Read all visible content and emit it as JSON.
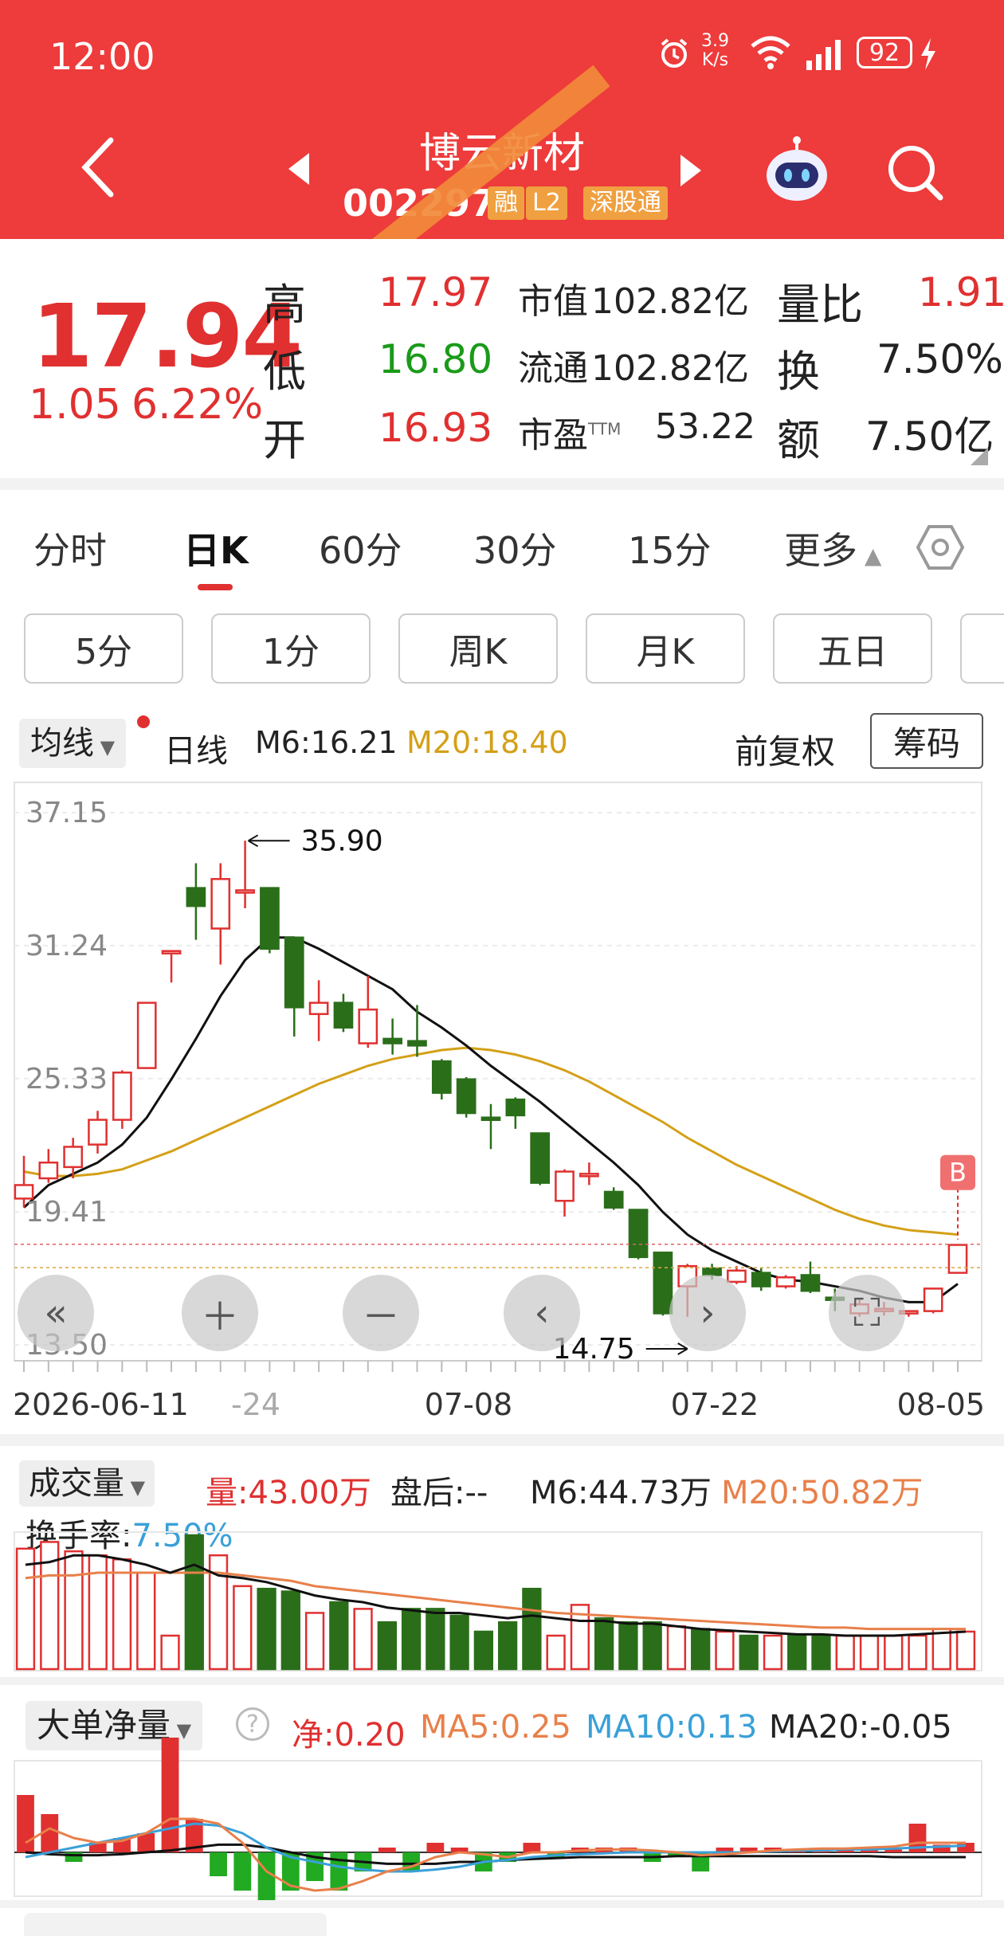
{
  "status_bar": {
    "time": "12:00",
    "net_speed_top": "3.9",
    "net_speed_unit": "K/s",
    "battery": "92"
  },
  "header": {
    "stock_name": "博云新材",
    "stock_code": "002297",
    "tags": [
      "融",
      "L2",
      "深股通"
    ]
  },
  "quote": {
    "price": "17.94",
    "change": "1.05",
    "change_pct": "6.22%",
    "high_label": "高",
    "high": "17.97",
    "low_label": "低",
    "low": "16.80",
    "open_label": "开",
    "open": "16.93",
    "mcap_label": "市值",
    "mcap": "102.82亿",
    "float_label": "流通",
    "float": "102.82亿",
    "pe_label": "市盈",
    "pe_sup": "TTM",
    "pe": "53.22",
    "vr_label": "量比",
    "vr": "1.91",
    "turnover_label": "换",
    "turnover": "7.50%",
    "amount_label": "额",
    "amount": "7.50亿"
  },
  "tabs": [
    "分时",
    "日K",
    "60分",
    "30分",
    "15分",
    "更多"
  ],
  "subtabs": [
    "5分",
    "1分",
    "周K",
    "月K",
    "五日"
  ],
  "ma_line": {
    "indicator": "均线",
    "period": "日线",
    "m6": "M6:16.21",
    "m20": "M20:18.40",
    "adjust": "前复权",
    "chip": "筹码"
  },
  "colors": {
    "header_red": "#ee3b3b",
    "up_red": "#e03030",
    "down_green": "#2a6e1a",
    "m20_gold": "#d4a017",
    "ma5_orange": "#e8804a",
    "ma10_blue": "#3aa0d8"
  },
  "chart_data": {
    "type": "candlestick",
    "y_ticks": [
      "37.15",
      "31.24",
      "25.33",
      "19.41",
      "13.50"
    ],
    "ylim": [
      13.5,
      37.15
    ],
    "x_ticks": [
      "2026-06-11",
      "-24",
      "07-08",
      "07-22",
      "08-05"
    ],
    "annotations": [
      {
        "label": "35.90",
        "marks": "high"
      },
      {
        "label": "14.75",
        "marks": "low"
      },
      {
        "label": "B",
        "marks": "buy"
      }
    ],
    "candles": [
      {
        "o": 20.0,
        "c": 20.6,
        "h": 21.9,
        "l": 19.6
      },
      {
        "o": 20.9,
        "c": 21.6,
        "h": 22.2,
        "l": 20.7
      },
      {
        "o": 21.4,
        "c": 22.3,
        "h": 22.7,
        "l": 20.9
      },
      {
        "o": 22.4,
        "c": 23.5,
        "h": 23.9,
        "l": 22.0
      },
      {
        "o": 23.5,
        "c": 25.6,
        "h": 25.7,
        "l": 23.1
      },
      {
        "o": 25.8,
        "c": 28.7,
        "h": 28.7,
        "l": 25.8
      },
      {
        "o": 31.0,
        "c": 31.0,
        "h": 31.0,
        "l": 29.6
      },
      {
        "o": 33.8,
        "c": 33.0,
        "h": 34.9,
        "l": 31.5
      },
      {
        "o": 32.0,
        "c": 34.2,
        "h": 34.9,
        "l": 30.4
      },
      {
        "o": 33.7,
        "c": 33.7,
        "h": 35.9,
        "l": 32.9
      },
      {
        "o": 33.8,
        "c": 31.1,
        "h": 33.8,
        "l": 30.9
      },
      {
        "o": 31.6,
        "c": 28.5,
        "h": 31.6,
        "l": 27.2
      },
      {
        "o": 28.2,
        "c": 28.7,
        "h": 29.7,
        "l": 27.0
      },
      {
        "o": 28.7,
        "c": 27.6,
        "h": 29.1,
        "l": 27.4
      },
      {
        "o": 26.9,
        "c": 28.4,
        "h": 29.9,
        "l": 26.7
      },
      {
        "o": 27.1,
        "c": 26.9,
        "h": 28.0,
        "l": 26.4
      },
      {
        "o": 27.0,
        "c": 26.8,
        "h": 28.6,
        "l": 26.3
      },
      {
        "o": 26.1,
        "c": 24.7,
        "h": 26.2,
        "l": 24.4
      },
      {
        "o": 25.3,
        "c": 23.8,
        "h": 25.4,
        "l": 23.6
      },
      {
        "o": 23.6,
        "c": 23.5,
        "h": 24.2,
        "l": 22.2
      },
      {
        "o": 24.4,
        "c": 23.7,
        "h": 24.5,
        "l": 23.1
      },
      {
        "o": 22.9,
        "c": 20.7,
        "h": 22.9,
        "l": 20.6
      },
      {
        "o": 19.9,
        "c": 21.2,
        "h": 21.3,
        "l": 19.2
      },
      {
        "o": 21.0,
        "c": 21.1,
        "h": 21.6,
        "l": 20.6
      },
      {
        "o": 20.3,
        "c": 19.6,
        "h": 20.5,
        "l": 19.5
      },
      {
        "o": 19.5,
        "c": 17.4,
        "h": 19.5,
        "l": 17.3
      },
      {
        "o": 17.6,
        "c": 14.9,
        "h": 17.6,
        "l": 14.8
      },
      {
        "o": 16.1,
        "c": 17.0,
        "h": 17.1,
        "l": 14.75
      },
      {
        "o": 16.9,
        "c": 16.6,
        "h": 17.1,
        "l": 16.4
      },
      {
        "o": 16.3,
        "c": 16.8,
        "h": 17.0,
        "l": 16.2
      },
      {
        "o": 16.7,
        "c": 16.1,
        "h": 16.9,
        "l": 15.9
      },
      {
        "o": 16.1,
        "c": 16.5,
        "h": 16.6,
        "l": 16.0
      },
      {
        "o": 16.6,
        "c": 15.9,
        "h": 17.2,
        "l": 15.8
      },
      {
        "o": 15.6,
        "c": 15.5,
        "h": 16.0,
        "l": 15.0
      },
      {
        "o": 14.9,
        "c": 15.3,
        "h": 15.5,
        "l": 14.75
      },
      {
        "o": 15.0,
        "c": 15.1,
        "h": 15.4,
        "l": 14.8
      },
      {
        "o": 14.9,
        "c": 15.0,
        "h": 15.0,
        "l": 14.75
      },
      {
        "o": 15.0,
        "c": 16.0,
        "h": 16.0,
        "l": 14.9
      },
      {
        "o": 16.7,
        "c": 17.94,
        "h": 17.97,
        "l": 16.8
      }
    ],
    "m6": [
      19.6,
      20.6,
      21.1,
      21.6,
      22.4,
      23.6,
      25.3,
      27.1,
      29.0,
      30.6,
      31.6,
      31.6,
      31.1,
      30.5,
      29.9,
      29.3,
      28.3,
      27.6,
      26.8,
      25.9,
      25.1,
      24.3,
      23.4,
      22.5,
      21.6,
      20.6,
      19.4,
      18.4,
      17.7,
      17.2,
      16.7,
      16.4,
      16.3,
      16.1,
      15.9,
      15.6,
      15.4,
      15.4,
      16.21
    ],
    "m20": [
      21.2,
      21.0,
      21.0,
      21.1,
      21.3,
      21.7,
      22.1,
      22.6,
      23.1,
      23.6,
      24.1,
      24.6,
      25.1,
      25.5,
      25.9,
      26.2,
      26.4,
      26.6,
      26.7,
      26.6,
      26.4,
      26.1,
      25.7,
      25.2,
      24.6,
      24.0,
      23.4,
      22.7,
      22.1,
      21.5,
      21.0,
      20.5,
      20.0,
      19.5,
      19.1,
      18.8,
      18.6,
      18.5,
      18.4
    ]
  },
  "volume": {
    "indicator": "成交量",
    "vol_label": "量:",
    "vol": "43.00万",
    "after_label": "盘后:--",
    "m6": "M6:44.73万",
    "m20": "M20:50.82万",
    "turnover_label": "换手率:",
    "turnover": "7.50%",
    "bars": [
      0.9,
      0.95,
      0.88,
      0.85,
      0.82,
      0.72,
      0.25,
      1.0,
      0.85,
      0.62,
      0.6,
      0.58,
      0.42,
      0.5,
      0.45,
      0.35,
      0.45,
      0.45,
      0.4,
      0.28,
      0.35,
      0.6,
      0.25,
      0.48,
      0.38,
      0.35,
      0.35,
      0.32,
      0.3,
      0.28,
      0.25,
      0.25,
      0.25,
      0.25,
      0.25,
      0.25,
      0.25,
      0.25,
      0.3,
      0.28
    ],
    "m6_line": [
      0.78,
      0.8,
      0.85,
      0.85,
      0.82,
      0.78,
      0.72,
      0.78,
      0.7,
      0.68,
      0.65,
      0.6,
      0.55,
      0.52,
      0.5,
      0.46,
      0.44,
      0.42,
      0.42,
      0.4,
      0.38,
      0.4,
      0.38,
      0.36,
      0.36,
      0.34,
      0.34,
      0.32,
      0.3,
      0.29,
      0.28,
      0.27,
      0.26,
      0.26,
      0.25,
      0.25,
      0.25,
      0.26,
      0.27,
      0.28
    ],
    "m20_line": [
      0.68,
      0.7,
      0.7,
      0.72,
      0.72,
      0.72,
      0.72,
      0.72,
      0.72,
      0.7,
      0.68,
      0.66,
      0.62,
      0.6,
      0.58,
      0.56,
      0.54,
      0.52,
      0.5,
      0.48,
      0.46,
      0.44,
      0.42,
      0.41,
      0.4,
      0.39,
      0.38,
      0.37,
      0.36,
      0.35,
      0.34,
      0.33,
      0.32,
      0.31,
      0.31,
      0.3,
      0.3,
      0.3,
      0.3,
      0.3
    ]
  },
  "flow": {
    "indicator": "大单净量",
    "net": "净:0.20",
    "ma5": "MA5:0.25",
    "ma10": "MA10:0.13",
    "ma20": "MA20:-0.05",
    "bars": [
      0.6,
      0.4,
      -0.1,
      0.1,
      0.15,
      0.2,
      1.2,
      0.35,
      -0.25,
      -0.4,
      -0.5,
      -0.4,
      -0.3,
      -0.4,
      -0.2,
      0.05,
      -0.2,
      0.1,
      0.05,
      -0.2,
      -0.1,
      0.1,
      -0.05,
      0.05,
      0.05,
      0.05,
      -0.1,
      -0.05,
      -0.2,
      0.05,
      0.05,
      0.05,
      0.03,
      0.02,
      0.05,
      0.05,
      0.03,
      0.3,
      0.08,
      0.1
    ],
    "ma5_line": [
      0.1,
      0.25,
      0.15,
      0.1,
      0.12,
      0.2,
      0.35,
      0.35,
      0.3,
      0.1,
      -0.2,
      -0.35,
      -0.4,
      -0.38,
      -0.3,
      -0.2,
      -0.15,
      -0.05,
      0.0,
      -0.02,
      -0.05,
      0.0,
      0.0,
      0.02,
      0.03,
      0.03,
      0.02,
      0.0,
      -0.03,
      -0.02,
      0.0,
      0.02,
      0.03,
      0.04,
      0.04,
      0.05,
      0.06,
      0.1,
      0.1,
      0.1
    ],
    "ma10_line": [
      -0.05,
      0.0,
      0.05,
      0.1,
      0.15,
      0.2,
      0.25,
      0.3,
      0.28,
      0.2,
      0.05,
      -0.05,
      -0.1,
      -0.15,
      -0.18,
      -0.2,
      -0.2,
      -0.18,
      -0.15,
      -0.1,
      -0.08,
      -0.05,
      -0.03,
      -0.02,
      -0.01,
      0.0,
      0.0,
      0.0,
      0.0,
      0.0,
      0.0,
      0.01,
      0.02,
      0.02,
      0.03,
      0.03,
      0.04,
      0.05,
      0.06,
      0.07
    ],
    "ma20_line": [
      0.0,
      -0.02,
      -0.03,
      -0.03,
      -0.02,
      0.0,
      0.02,
      0.05,
      0.08,
      0.08,
      0.05,
      0.0,
      -0.05,
      -0.08,
      -0.1,
      -0.12,
      -0.12,
      -0.12,
      -0.1,
      -0.1,
      -0.08,
      -0.07,
      -0.06,
      -0.05,
      -0.05,
      -0.05,
      -0.05,
      -0.04,
      -0.04,
      -0.04,
      -0.04,
      -0.04,
      -0.04,
      -0.04,
      -0.04,
      -0.04,
      -0.05,
      -0.05,
      -0.05,
      -0.05
    ]
  }
}
